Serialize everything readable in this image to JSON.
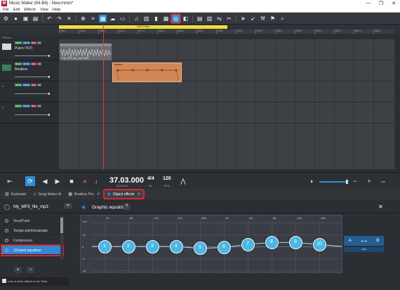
{
  "window": {
    "title": "Music Maker (64-Bit) - New.mmm*",
    "logo": "M",
    "controls": [
      "—",
      "❐",
      "✕"
    ]
  },
  "menu": [
    "File",
    "Edit",
    "Effects",
    "View",
    "Help"
  ],
  "toolbar": {
    "icons": [
      "gear-icon",
      "record-icon",
      "save-icon",
      "load-icon",
      "undo-icon",
      "redo-icon",
      "delete-icon",
      "add-icon",
      "mixer-icon",
      "browser-icon",
      "upload-icon",
      "media-icon",
      "notation-icon",
      "midi-icon",
      "keyboard-icon",
      "beatbox-icon",
      "object-effects-icon",
      "fx-icon",
      "select-icon",
      "tool-icon",
      "marker-icon",
      "zoom-icon"
    ]
  },
  "loop_label": "11/8+1 Bars",
  "ruler": [
    "001:1",
    "005:1",
    "009:1",
    "013:1",
    "017:1",
    "021:1",
    "025:1",
    "029:1",
    "033:1",
    "037:1",
    "041:1",
    "045:1",
    "049:1",
    "053:1",
    "057:1",
    "061:1",
    "065:1"
  ],
  "pitches_label": "Pitches",
  "tracks": [
    {
      "num": "1",
      "name": "Piano VSTi",
      "buttons": [
        "SOLO",
        "MUTE",
        "REC",
        "FX"
      ]
    },
    {
      "num": "2",
      "name": "Beatbox",
      "buttons": [
        "SOLO",
        "MUTE",
        "REC",
        "FX"
      ]
    },
    {
      "num": "3",
      "name": "",
      "buttons": [
        "SOLO",
        "MUTE",
        "REC",
        "FX"
      ]
    },
    {
      "num": "4",
      "name": "",
      "buttons": [
        "SOLO",
        "MUTE",
        "REC",
        "FX"
      ]
    }
  ],
  "clips": {
    "audio_label": "My_MP3_file_mp3.MDP",
    "beat_label": "Beatbox"
  },
  "transport": {
    "time": "37.03.000",
    "time_sub": "BAR BEAT",
    "tsig": "4/4",
    "tsig_sub": "Bar",
    "bpm": "120",
    "bpm_sub": "BPM"
  },
  "tabs": [
    {
      "label": "Keyboard",
      "icon": "keyboard-icon"
    },
    {
      "label": "Song Maker AI",
      "icon": "song-maker-icon"
    },
    {
      "label": "Beatbox Pro",
      "icon": "beatbox-icon"
    },
    {
      "label": "Object effects",
      "icon": "object-effects-icon"
    }
  ],
  "object_name": "My_MP3_file_mp3",
  "effects": [
    "VocalTune",
    "Tempo-pitch/resample",
    "Compressor",
    "10-band equalizer"
  ],
  "store_text": "Lots of other effects in the Store",
  "eq": {
    "title": "Graphic equalizer",
    "help": "?",
    "freqs": [
      "32",
      "60",
      "170",
      "310",
      "600",
      "1K",
      "3K",
      "6K",
      "12K",
      "16K"
    ],
    "db_labels": [
      "+12",
      "+6",
      "0",
      "-6",
      "-12"
    ],
    "band_gains_db": [
      0,
      0,
      0,
      0,
      -1,
      -0.5,
      1,
      2,
      2,
      1
    ]
  },
  "ab": {
    "a": "A",
    "b": "B",
    "link": "Link"
  },
  "colors": {
    "accent": "#2b8fd8",
    "highlight_outline": "#e0242b",
    "band_fill": "#49b7e8",
    "loop": "#ece036",
    "beat_clip": "#d28856"
  }
}
